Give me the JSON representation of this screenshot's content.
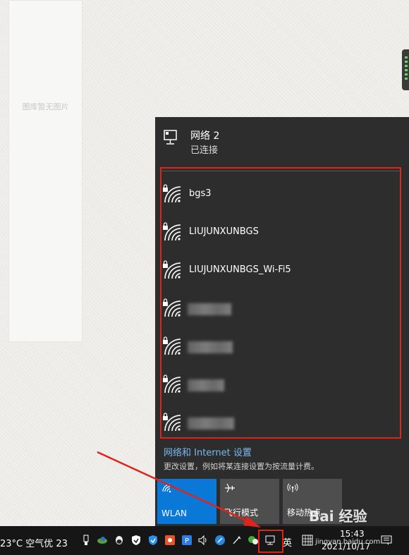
{
  "background": {
    "placeholder_text": "图库暂无图片"
  },
  "network_panel": {
    "connected": {
      "name": "网络 2",
      "status": "已连接"
    },
    "wifi_networks": [
      {
        "ssid": "bgs3",
        "secured": true,
        "visible": true
      },
      {
        "ssid": "LIUJUNXUNBGS",
        "secured": true,
        "visible": true
      },
      {
        "ssid": "LIUJUNXUNBGS_Wi-Fi5",
        "secured": true,
        "visible": true
      },
      {
        "ssid": "",
        "secured": true,
        "visible": false
      },
      {
        "ssid": "",
        "secured": true,
        "visible": false
      },
      {
        "ssid": "",
        "secured": true,
        "visible": false
      },
      {
        "ssid": "",
        "secured": true,
        "visible": false
      }
    ],
    "settings_link": "网络和 Internet 设置",
    "settings_description": "更改设置，例如将某连接设置为按流量计费。",
    "quick_actions": [
      {
        "label": "WLAN",
        "icon": "wifi-icon",
        "active": true
      },
      {
        "label": "飞行模式",
        "icon": "airplane-icon",
        "active": false
      },
      {
        "label": "移动热点",
        "icon": "hotspot-icon",
        "active": false
      }
    ]
  },
  "taskbar": {
    "weather": "23°C  空气优 23",
    "ime": "英",
    "time": "15:43",
    "date": "2021/10/17",
    "tray_icons": [
      "usb-icon",
      "network-globe-icon",
      "qq-icon",
      "security-shield-icon",
      "defender-icon",
      "app-icon",
      "p-icon",
      "volume-icon",
      "feather-icon",
      "pen-icon",
      "wechat-icon",
      "network-icon",
      "ime-icon",
      "grid-icon",
      "notification-icon"
    ]
  },
  "watermark": {
    "brand": "Bai 经验",
    "url": "jingyan.baidu.com"
  },
  "colors": {
    "panel_bg": "#2d2d2d",
    "accent": "#0a78d7",
    "highlight_red": "#e2231a",
    "link": "#79b8ef"
  }
}
